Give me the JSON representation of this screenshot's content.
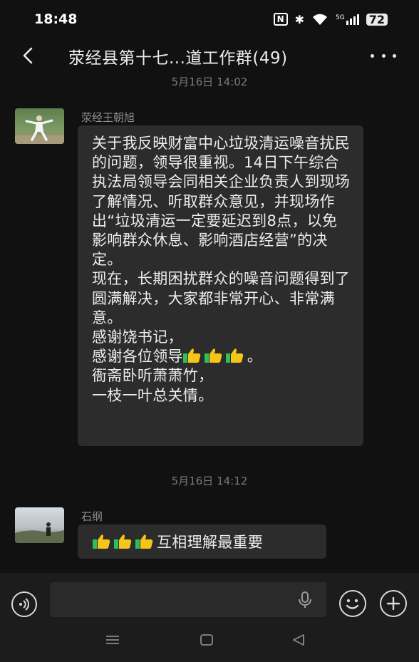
{
  "status_bar": {
    "time": "18:48",
    "nfc": "N",
    "bluetooth": "✱",
    "network": "5G",
    "battery": "72"
  },
  "header": {
    "title": "荥经县第十七...道工作群(49)"
  },
  "messages": [
    {
      "timestamp": "5月16日 14:02",
      "sender": "荥经王朝旭",
      "paragraphs": [
        "关于我反映财富中心垃圾清运噪音扰民的问题，领导很重视。14日下午综合执法局领导会同相关企业负责人到现场了解情况、听取群众意见，并现场作出“垃圾清运一定要延迟到8点，以免影响群众休息、影响酒店经营”的决定。",
        "现在，长期困扰群众的噪音问题得到了圆满解决，大家都非常开心、非常满意。",
        "感谢饶书记，",
        "感谢各位领导",
        "衙斋卧听萧萧竹，",
        "一枝一叶总关情。"
      ]
    },
    {
      "timestamp": "5月16日 14:12",
      "sender": "石纲",
      "text": "互相理解最重要"
    }
  ],
  "colors": {
    "background": "#111111",
    "bubble": "#2c2c2c",
    "thumbs": "#f5c518",
    "thumbs_cuff": "#2fbf5a"
  }
}
